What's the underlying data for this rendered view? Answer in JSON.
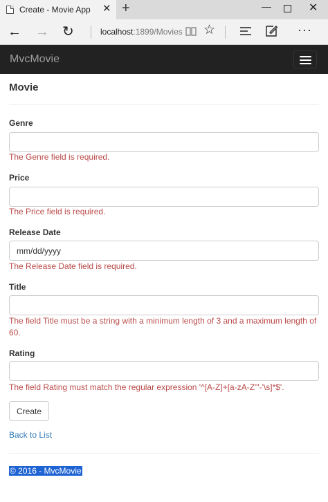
{
  "browser": {
    "tab_title": "Create - Movie App",
    "tab_close": "✕",
    "new_tab": "+",
    "win_min": "—",
    "win_close": "✕",
    "url_host": "localhost",
    "url_rest": ":1899/Movies",
    "back_glyph": "←",
    "forward_glyph": "→",
    "refresh_glyph": "↻",
    "favorite_glyph": "☆",
    "more_glyph": "···"
  },
  "navbar": {
    "brand": "MvcMovie"
  },
  "page": {
    "heading": "Movie"
  },
  "form": {
    "genre": {
      "label": "Genre",
      "value": "",
      "error": "The Genre field is required."
    },
    "price": {
      "label": "Price",
      "value": "",
      "error": "The Price field is required."
    },
    "release_date": {
      "label": "Release Date",
      "placeholder": "mm/dd/yyyy",
      "error": "The Release Date field is required."
    },
    "title": {
      "label": "Title",
      "value": "",
      "error": "The field Title must be a string with a minimum length of 3 and a maximum length of 60."
    },
    "rating": {
      "label": "Rating",
      "value": "",
      "error": "The field Rating must match the regular expression '^[A-Z]+[a-zA-Z\"'-'\\s]*$'."
    },
    "submit_label": "Create"
  },
  "links": {
    "back_to_list": "Back to List"
  },
  "footer": {
    "text": "© 2016 - MvcMovie"
  },
  "colors": {
    "navbar_bg": "#222222",
    "error_text": "#b94a48",
    "link": "#337ab7",
    "selection": "#1e63d4"
  }
}
